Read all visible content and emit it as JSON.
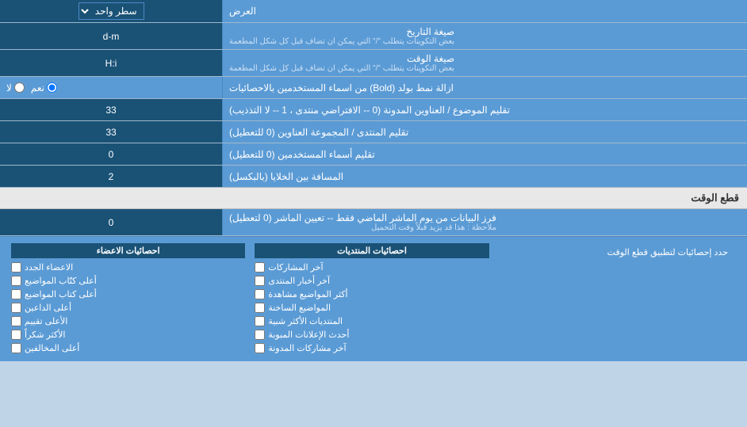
{
  "header": {
    "section_label": "العرض",
    "dropdown_label": "سطر واحد"
  },
  "rows": [
    {
      "id": "date_format",
      "label": "صيغة التاريخ",
      "sublabel": "بعض التكوينات يتطلب \"/\" التي يمكن ان تضاف قبل كل شكل المطعمة",
      "value": "d-m",
      "type": "text"
    },
    {
      "id": "time_format",
      "label": "صيغة الوقت",
      "sublabel": "بعض التكوينات يتطلب \"/\" التي يمكن ان تضاف قبل كل شكل المطعمة",
      "value": "H:i",
      "type": "text"
    },
    {
      "id": "bold_remove",
      "label": "ازالة نمط بولد (Bold) من اسماء المستخدمين بالاحصائيات",
      "type": "radio",
      "options": [
        {
          "value": "yes",
          "label": "نعم",
          "checked": true
        },
        {
          "value": "no",
          "label": "لا",
          "checked": false
        }
      ]
    },
    {
      "id": "topic_titles",
      "label": "تقليم الموضوع / العناوين المدونة (0 -- الافتراضي منتدى ، 1 -- لا التذذيب)",
      "value": "33",
      "type": "text"
    },
    {
      "id": "forum_titles",
      "label": "تقليم المنتدى / المجموعة العناوين (0 للتعطيل)",
      "value": "33",
      "type": "text"
    },
    {
      "id": "user_names",
      "label": "تقليم أسماء المستخدمين (0 للتعطيل)",
      "value": "0",
      "type": "text"
    },
    {
      "id": "cell_gap",
      "label": "المسافة بين الخلايا (بالبكسل)",
      "value": "2",
      "type": "text"
    }
  ],
  "cutoff_section": {
    "title": "قطع الوقت",
    "apply_label": "حدد إحصائيات لتطبيق قطع الوقت",
    "cutoff_row": {
      "label": "فرز البيانات من يوم الماشر الماضي فقط -- تعيين الماشر (0 لتعطيل)",
      "note": "ملاحظة : هذا قد يزيد قبلاً وقت التحميل",
      "value": "0"
    }
  },
  "stats": {
    "posts_col": {
      "title": "احصائيات المنتديات",
      "items": [
        {
          "label": "آخر المشاركات",
          "checked": false
        },
        {
          "label": "آخر أخبار المنتدى",
          "checked": false
        },
        {
          "label": "أكثر المواضيع مشاهدة",
          "checked": false
        },
        {
          "label": "المواضيع الساخنة",
          "checked": false
        },
        {
          "label": "المنتديات الأكثر شبية",
          "checked": false
        },
        {
          "label": "أحدث الإعلانات المبوبة",
          "checked": false
        },
        {
          "label": "آخر مشاركات المدونة",
          "checked": false
        }
      ]
    },
    "members_col": {
      "title": "احصائيات الاعضاء",
      "items": [
        {
          "label": "الاعضاء الجدد",
          "checked": false
        },
        {
          "label": "أعلى كتّاب المواضيع",
          "checked": false
        },
        {
          "label": "أعلى كتاب المواضيع",
          "checked": false
        },
        {
          "label": "أعلى الداعين",
          "checked": false
        },
        {
          "label": "الأعلى تقييم",
          "checked": false
        },
        {
          "label": "الأكثر شكراً",
          "checked": false
        },
        {
          "label": "أعلى المخالفين",
          "checked": false
        }
      ]
    }
  }
}
